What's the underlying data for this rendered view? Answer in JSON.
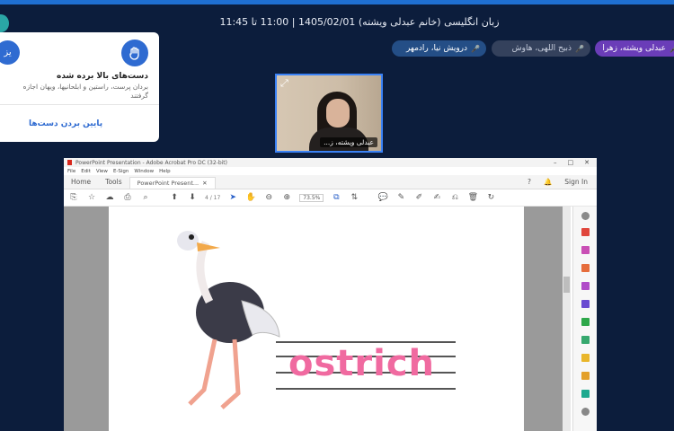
{
  "session": {
    "title": "زبان انگلیسی (خانم عبدلی ویشته) 1405/02/01 | 11:00 تا 11:45"
  },
  "participants": [
    {
      "name": "عبدلی ویشته، زهرا",
      "style": "speaking",
      "color": "#6a3db8"
    },
    {
      "name": "ذبیح اللهی، هاوش",
      "style": "muted",
      "color": "#34415c"
    },
    {
      "name": "درویش نیا، رادمهر",
      "style": "active",
      "color": "#244e86"
    }
  ],
  "hand_raise_popup": {
    "title": "دست‌های بالا برده شده",
    "body": "بردان پرست، راستین و ابلحانیها، ویهان اجازه گرفتند",
    "action_label": "پایین بردن دست‌ها",
    "side_button_label": "یز",
    "icon": "raised-hand-icon"
  },
  "video": {
    "name_tag": "عبدلی ویشته، ز..."
  },
  "acrobat": {
    "window_title": "PowerPoint Presentation - Adobe Acrobat Pro DC (32-bit)",
    "menu": [
      "File",
      "Edit",
      "View",
      "E-Sign",
      "Window",
      "Help"
    ],
    "tabs": {
      "home": "Home",
      "tools": "Tools",
      "document": "PowerPoint Present..."
    },
    "help_icon": "?",
    "sign_in": "Sign In",
    "page_indicator": "4 / 17",
    "zoom": "73.5%",
    "slide_word": "ostrich"
  }
}
